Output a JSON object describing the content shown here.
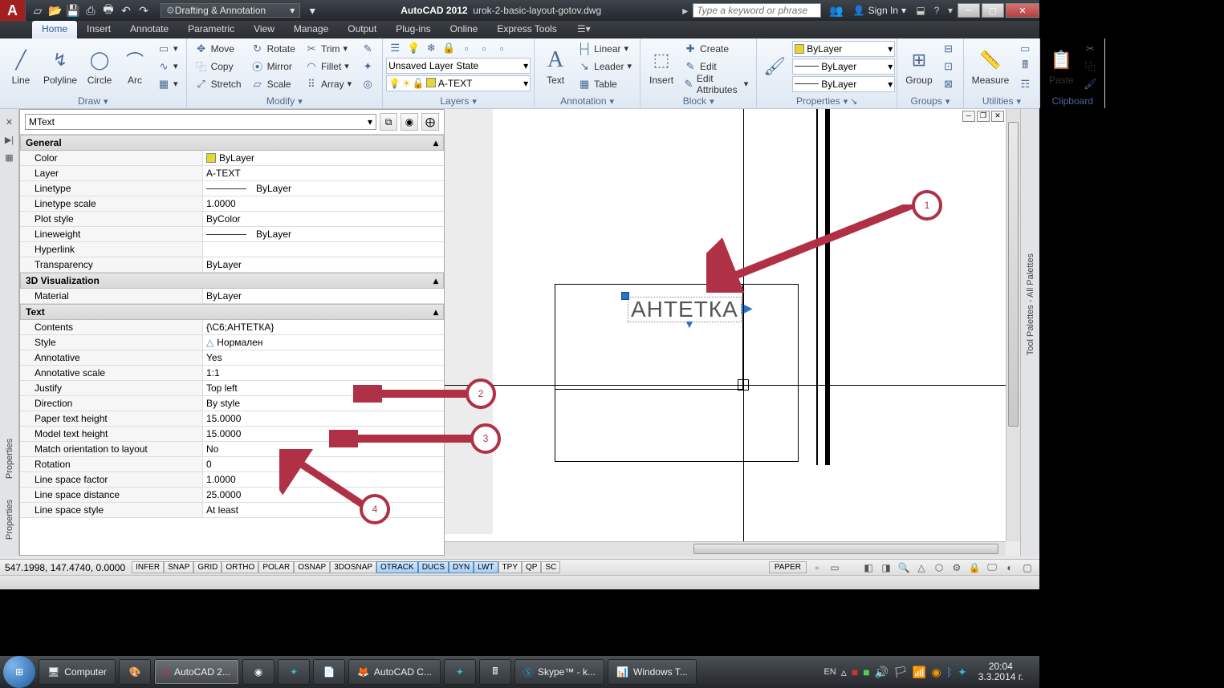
{
  "title": {
    "app": "AutoCAD 2012",
    "file": "urok-2-basic-layout-gotov.dwg"
  },
  "workspace": "Drafting & Annotation",
  "search_placeholder": "Type a keyword or phrase",
  "signin": "Sign In",
  "tabs": [
    "Home",
    "Insert",
    "Annotate",
    "Parametric",
    "View",
    "Manage",
    "Output",
    "Plug-ins",
    "Online",
    "Express Tools"
  ],
  "ribbon": {
    "draw": {
      "label": "Draw",
      "line": "Line",
      "polyline": "Polyline",
      "circle": "Circle",
      "arc": "Arc"
    },
    "modify": {
      "label": "Modify",
      "move": "Move",
      "rotate": "Rotate",
      "trim": "Trim",
      "copy": "Copy",
      "mirror": "Mirror",
      "fillet": "Fillet",
      "stretch": "Stretch",
      "scale": "Scale",
      "array": "Array"
    },
    "layers": {
      "label": "Layers",
      "state": "Unsaved Layer State",
      "current": "A-TEXT"
    },
    "annotation": {
      "label": "Annotation",
      "text": "Text",
      "linear": "Linear",
      "leader": "Leader",
      "table": "Table"
    },
    "block": {
      "label": "Block",
      "insert": "Insert",
      "create": "Create",
      "edit": "Edit",
      "editattr": "Edit Attributes"
    },
    "properties": {
      "label": "Properties",
      "color": "ByLayer",
      "line": "ByLayer",
      "weight": "ByLayer"
    },
    "groups": {
      "label": "Groups",
      "group": "Group"
    },
    "utilities": {
      "label": "Utilities",
      "measure": "Measure"
    },
    "clipboard": {
      "label": "Clipboard",
      "paste": "Paste"
    }
  },
  "prop": {
    "selector": "MText",
    "general": {
      "label": "General",
      "rows": [
        {
          "k": "Color",
          "v": "ByLayer",
          "swatch": "#e5d632"
        },
        {
          "k": "Layer",
          "v": "A-TEXT"
        },
        {
          "k": "Linetype",
          "v": "ByLayer",
          "line": true
        },
        {
          "k": "Linetype scale",
          "v": "1.0000"
        },
        {
          "k": "Plot style",
          "v": "ByColor"
        },
        {
          "k": "Lineweight",
          "v": "ByLayer",
          "line": true
        },
        {
          "k": "Hyperlink",
          "v": ""
        },
        {
          "k": "Transparency",
          "v": "ByLayer"
        }
      ]
    },
    "viz": {
      "label": "3D Visualization",
      "rows": [
        {
          "k": "Material",
          "v": "ByLayer"
        }
      ]
    },
    "text": {
      "label": "Text",
      "rows": [
        {
          "k": "Contents",
          "v": "{\\C6;АНТЕТКА}"
        },
        {
          "k": "Style",
          "v": "Нормален",
          "icon": "△"
        },
        {
          "k": "Annotative",
          "v": "Yes"
        },
        {
          "k": "Annotative scale",
          "v": "1:1"
        },
        {
          "k": "Justify",
          "v": "Top left"
        },
        {
          "k": "Direction",
          "v": "By style"
        },
        {
          "k": "Paper text height",
          "v": "15.0000"
        },
        {
          "k": "Model text height",
          "v": "15.0000"
        },
        {
          "k": "Match orientation to layout",
          "v": "No"
        },
        {
          "k": "Rotation",
          "v": "0"
        },
        {
          "k": "Line space factor",
          "v": "1.0000"
        },
        {
          "k": "Line space distance",
          "v": "25.0000"
        },
        {
          "k": "Line space style",
          "v": "At least"
        }
      ]
    }
  },
  "side": {
    "properties": "Properties",
    "toolpalettes": "Tool Palettes - All Palettes"
  },
  "drawing_text": "АНТЕТКА",
  "status": {
    "coords": "547.1998, 147.4740, 0.0000",
    "toggles": [
      "INFER",
      "SNAP",
      "GRID",
      "ORTHO",
      "POLAR",
      "OSNAP",
      "3DOSNAP",
      "OTRACK",
      "DUCS",
      "DYN",
      "LWT",
      "TPY",
      "QP",
      "SC"
    ],
    "active_toggles": [
      "OTRACK",
      "DUCS",
      "DYN",
      "LWT"
    ],
    "space": "PAPER"
  },
  "taskbar": {
    "computer": "Computer",
    "acad": "AutoCAD 2...",
    "firefox": "AutoCAD C...",
    "skype": "Skype™ - k...",
    "wintask": "Windows T...",
    "lang": "EN",
    "time": "20:04",
    "date": "3.3.2014 г."
  },
  "annotations": {
    "a1": "1",
    "a2": "2",
    "a3": "3",
    "a4": "4"
  }
}
